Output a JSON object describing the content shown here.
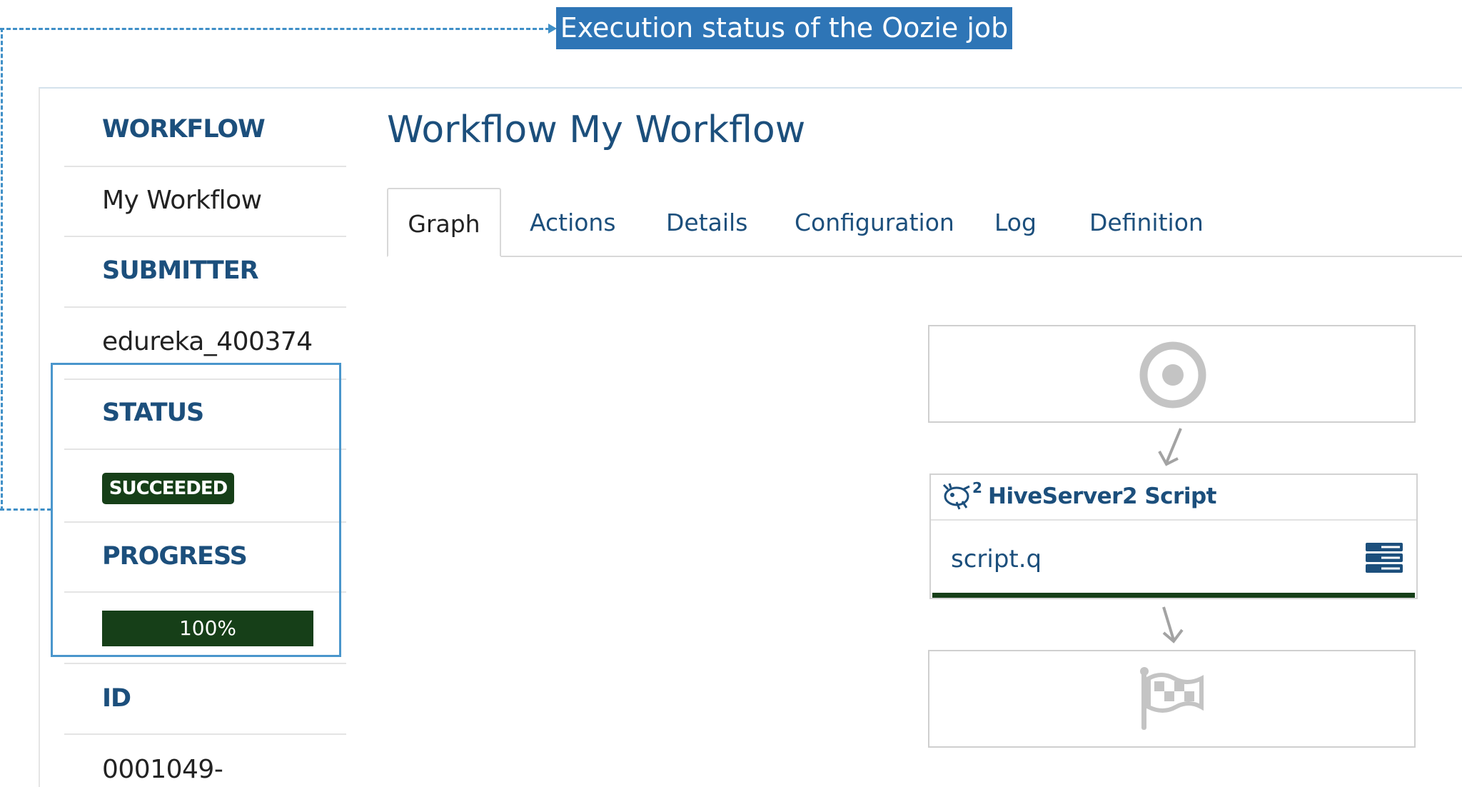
{
  "annotation": {
    "callout_text": "Execution status of the Oozie job"
  },
  "sidebar": {
    "workflow_label": "WORKFLOW",
    "workflow_value": "My Workflow",
    "submitter_label": "SUBMITTER",
    "submitter_value": "edureka_400374",
    "status_label": "STATUS",
    "status_value": "SUCCEEDED",
    "progress_label": "PROGRESS",
    "progress_text": "100%",
    "progress_percent": 100,
    "id_label": "ID",
    "id_value": "0001049-"
  },
  "main": {
    "title": "Workflow My Workflow",
    "tabs": [
      {
        "label": "Graph",
        "active": true
      },
      {
        "label": "Actions"
      },
      {
        "label": "Details"
      },
      {
        "label": "Configuration"
      },
      {
        "label": "Log"
      },
      {
        "label": "Definition"
      }
    ]
  },
  "graph": {
    "start_icon": "target-icon",
    "action": {
      "icon": "hive-icon",
      "badge": "2",
      "title": "HiveServer2 Script",
      "script": "script.q",
      "menu_icon": "list-icon"
    },
    "end_icon": "flag-icon"
  },
  "colors": {
    "accent": "#1c4f7c",
    "success": "#163f18",
    "annotation": "#2e75b6"
  }
}
